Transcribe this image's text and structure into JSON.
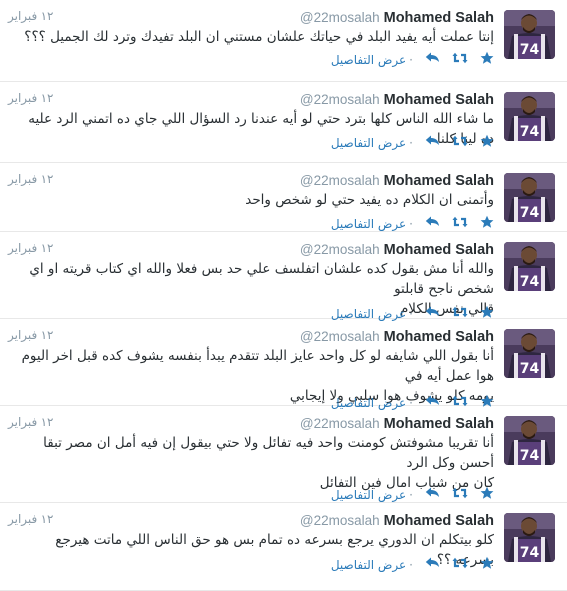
{
  "colors": {
    "link": "#2b7bb9",
    "muted": "#8899a6",
    "accent": "#55acee",
    "text": "#292f33"
  },
  "account": {
    "name": "Mohamed Salah",
    "handle": "@22mosalah"
  },
  "details_label": "عرض التفاصيل",
  "tweets": [
    {
      "time": "١٢ فبراير",
      "lines": [
        "إنتا عملت أيه يفيد البلد في حياتك علشان مستني ان البلد تفيدك وترد لك الجميل ؟؟؟"
      ]
    },
    {
      "time": "١٢ فبراير",
      "lines": [
        "ما شاء الله الناس كلها بترد حتي لو أيه عندنا رد السؤال اللي جاي ده اتمني الرد عليه ده لينا كلنا"
      ]
    },
    {
      "time": "١٢ فبراير",
      "lines": [
        "وأتمنى ان الكلام ده يفيد حتي لو شخص واحد"
      ]
    },
    {
      "time": "١٢ فبراير",
      "lines": [
        "والله أنا مش بقول كده علشان اتفلسف علي حد بس فعلا والله اي كتاب قريته او اي شخص ناجح قابلتو",
        "قالي نفس الكلام"
      ]
    },
    {
      "time": "١٢ فبراير",
      "lines": [
        "أنا بقول اللي شايفه لو كل واحد عايز البلد تتقدم يبدأ بنفسه يشوف كده قبل اخر اليوم هوا عمل أيه في",
        "يومه كلو يشوف هوا سلبي ولا إيجابي"
      ]
    },
    {
      "time": "١٢ فبراير",
      "lines": [
        "أنا تقريبا مشوفتش كومنت واحد فيه تفائل ولا حتي بيقول إن فيه أمل ان مصر تبقا أحسن وكل الرد",
        "كان من شباب امال فين التفائل"
      ]
    },
    {
      "time": "١٢ فبراير",
      "lines": [
        "كلو بيتكلم ان الدوري يرجع بسرعه ده تمام بس هو حق الناس اللي ماتت هيرجع بسرعه ؟؟"
      ]
    }
  ],
  "avatar_jersey_number": "74"
}
